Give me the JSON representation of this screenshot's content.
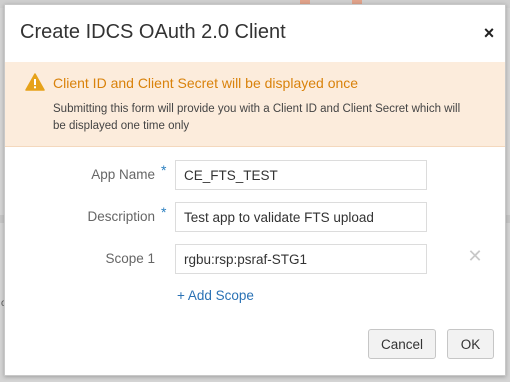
{
  "dialog": {
    "title": "Create IDCS OAuth 2.0 Client",
    "close_symbol": "×"
  },
  "warning": {
    "icon": "warning-triangle-icon",
    "title": "Client ID and Client Secret will be displayed once",
    "body": "Submitting this form will provide you with a Client ID and Client Secret which will be displayed one time only"
  },
  "form": {
    "app_name_label": "App Name",
    "app_name_value": "CE_FTS_TEST",
    "description_label": "Description",
    "description_value": "Test app to validate FTS upload",
    "scope1_label": "Scope 1",
    "scope1_value": "rgbu:rsp:psraf-STG1",
    "required_marker": "*",
    "add_scope": "+ Add Scope",
    "remove_symbol": "✕"
  },
  "buttons": {
    "cancel": "Cancel",
    "ok": "OK"
  },
  "background": {
    "edge_text": "o"
  },
  "colors": {
    "warning_bg": "#fcecdc",
    "warning_text": "#d9820b",
    "link": "#2a72b5",
    "required": "#2a7fc0"
  }
}
